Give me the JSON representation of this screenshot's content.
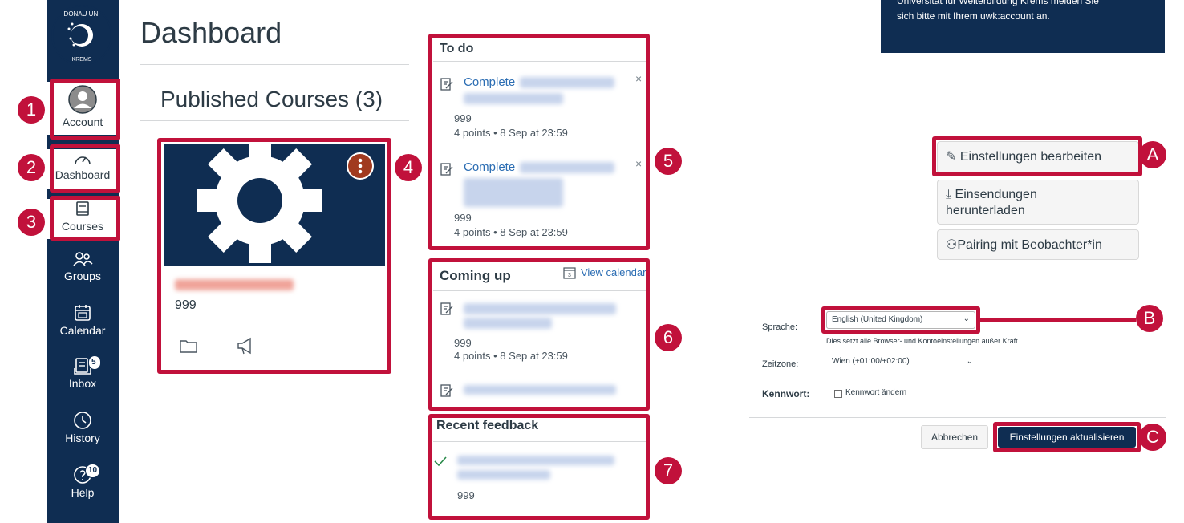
{
  "sidebar": {
    "logo_text": "DONAU UNIVERSITÄT KREMS",
    "items": [
      {
        "label": "Account",
        "icon": "user-avatar-icon"
      },
      {
        "label": "Dashboard",
        "icon": "dashboard-gauge-icon"
      },
      {
        "label": "Courses",
        "icon": "courses-book-icon"
      },
      {
        "label": "Groups",
        "icon": "groups-icon"
      },
      {
        "label": "Calendar",
        "icon": "calendar-icon"
      },
      {
        "label": "Inbox",
        "icon": "inbox-icon",
        "badge": "5"
      },
      {
        "label": "History",
        "icon": "history-clock-icon"
      },
      {
        "label": "Help",
        "icon": "help-icon",
        "badge": "10"
      }
    ]
  },
  "main": {
    "title": "Dashboard",
    "subtitle": "Published Courses (3)",
    "course_card": {
      "count": "999",
      "icons": [
        "folder-icon",
        "announcement-megaphone-icon"
      ]
    }
  },
  "todo": {
    "title": "To do",
    "items": [
      {
        "action": "Complete",
        "count": "999",
        "meta": "4 points • 8 Sep at 23:59"
      },
      {
        "action": "Complete",
        "count": "999",
        "meta": "4 points • 8 Sep at 23:59"
      }
    ]
  },
  "coming_up": {
    "title": "Coming up",
    "view_calendar": "View calendar",
    "items": [
      {
        "count": "999",
        "meta": "4 points • 8 Sep at 23:59"
      }
    ]
  },
  "recent_feedback": {
    "title": "Recent feedback",
    "items": [
      {
        "count": "999"
      }
    ]
  },
  "markers": [
    "1",
    "2",
    "3",
    "4",
    "5",
    "6",
    "7",
    "A",
    "B",
    "C"
  ],
  "settings": {
    "banner_line1": "Universität für Weiterbildung Krems melden Sie",
    "banner_line2": "sich bitte mit Ihrem uwk:account an.",
    "buttons": {
      "edit": "Einstellungen bearbeiten",
      "download_line1": "Einsendungen",
      "download_line2": "herunterladen",
      "pairing": "Pairing mit Beobachter*in"
    },
    "language_label": "Sprache:",
    "language_value": "English (United Kingdom)",
    "language_note": "Dies setzt alle Browser- und Kontoeinstellungen außer Kraft.",
    "timezone_label": "Zeitzone:",
    "timezone_value": "Wien (+01:00/+02:00)",
    "password_label": "Kennwort:",
    "password_checkbox": "Kennwort ändern",
    "cancel": "Abbrechen",
    "update": "Einstellungen aktualisieren"
  },
  "colors": {
    "navy": "#0f2d52",
    "annotation_red": "#c1113b",
    "link": "#2b6db3",
    "course_icon_bg": "#a13a1f"
  }
}
